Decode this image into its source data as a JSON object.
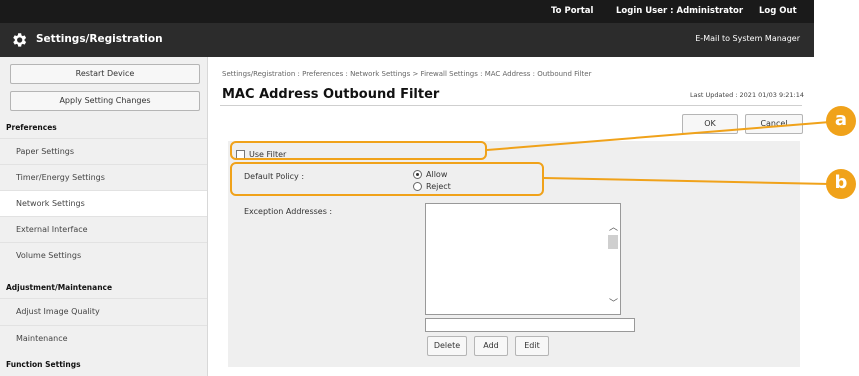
{
  "header": {
    "to_portal": "To Portal",
    "login_user": "Login User :  Administrator",
    "logout": "Log Out",
    "app_title": "Settings/Registration",
    "mail_link": "E-Mail to System Manager"
  },
  "sidebar": {
    "restart_label": "Restart Device",
    "apply_label": "Apply Setting Changes",
    "section_preferences": "Preferences",
    "items_preferences": [
      "Paper Settings",
      "Timer/Energy Settings",
      "Network Settings",
      "External Interface",
      "Volume Settings"
    ],
    "section_adjust": "Adjustment/Maintenance",
    "items_adjust": [
      "Adjust Image Quality",
      "Maintenance"
    ],
    "section_function": "Function Settings"
  },
  "main": {
    "breadcrumb": "Settings/Registration : Preferences : Network Settings > Firewall Settings : MAC Address : Outbound Filter",
    "title": "MAC Address Outbound Filter",
    "last_updated": "Last Updated : 2021 01/03 9:21:14",
    "ok_label": "OK",
    "cancel_label": "Cancel",
    "use_filter_label": "Use Filter",
    "default_policy_label": "Default Policy :",
    "allow_label": "Allow",
    "reject_label": "Reject",
    "exception_label": "Exception Addresses :",
    "delete_label": "Delete",
    "add_label": "Add",
    "edit_label": "Edit"
  },
  "callouts": [
    "a",
    "b"
  ],
  "colors": {
    "accent": "#f0a21a",
    "header_bg": "#1a1a1a",
    "titlebar_bg": "#2c2c2c"
  }
}
